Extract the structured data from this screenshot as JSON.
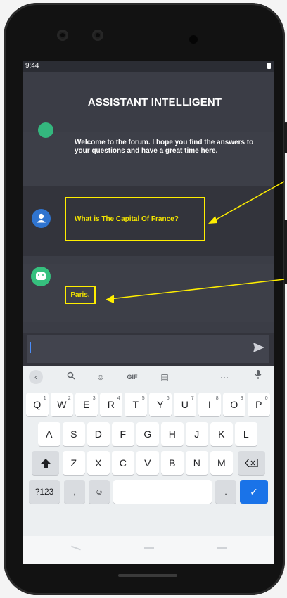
{
  "status_bar": {
    "time": "9:44"
  },
  "app": {
    "title": "ASSISTANT INTELLIGENT"
  },
  "messages": [
    {
      "sender": "bot",
      "text": "Welcome to the forum. I hope you find the answers to your questions and have a great time here."
    },
    {
      "sender": "user",
      "text": "What is The Capital Of France?"
    },
    {
      "sender": "bot",
      "text": "Paris."
    }
  ],
  "input": {
    "value": "",
    "send_icon": "send-icon"
  },
  "keyboard": {
    "toolbar": [
      "<",
      "search-icon",
      "sticker-icon",
      "GIF",
      "clipboard-icon",
      "...",
      "mic-icon"
    ],
    "gif_label": "GIF",
    "more_label": "···",
    "row1": [
      "Q",
      "W",
      "E",
      "R",
      "T",
      "Y",
      "U",
      "I",
      "O",
      "P"
    ],
    "row1_hints": [
      "1",
      "2",
      "3",
      "4",
      "5",
      "6",
      "7",
      "8",
      "9",
      "0"
    ],
    "row2": [
      "A",
      "S",
      "D",
      "F",
      "G",
      "H",
      "J",
      "K",
      "L"
    ],
    "row3": [
      "Z",
      "X",
      "C",
      "V",
      "B",
      "N",
      "M"
    ],
    "symbols_label": "?123",
    "comma_label": ",",
    "period_label": ".",
    "enter_label": "✓"
  },
  "colors": {
    "annotation": "#ffee00",
    "screen_bg": "#3b3d46",
    "user_avatar": "#2f74d0",
    "bot_avatar": "#36c07e",
    "enter_key": "#1a73e8"
  }
}
